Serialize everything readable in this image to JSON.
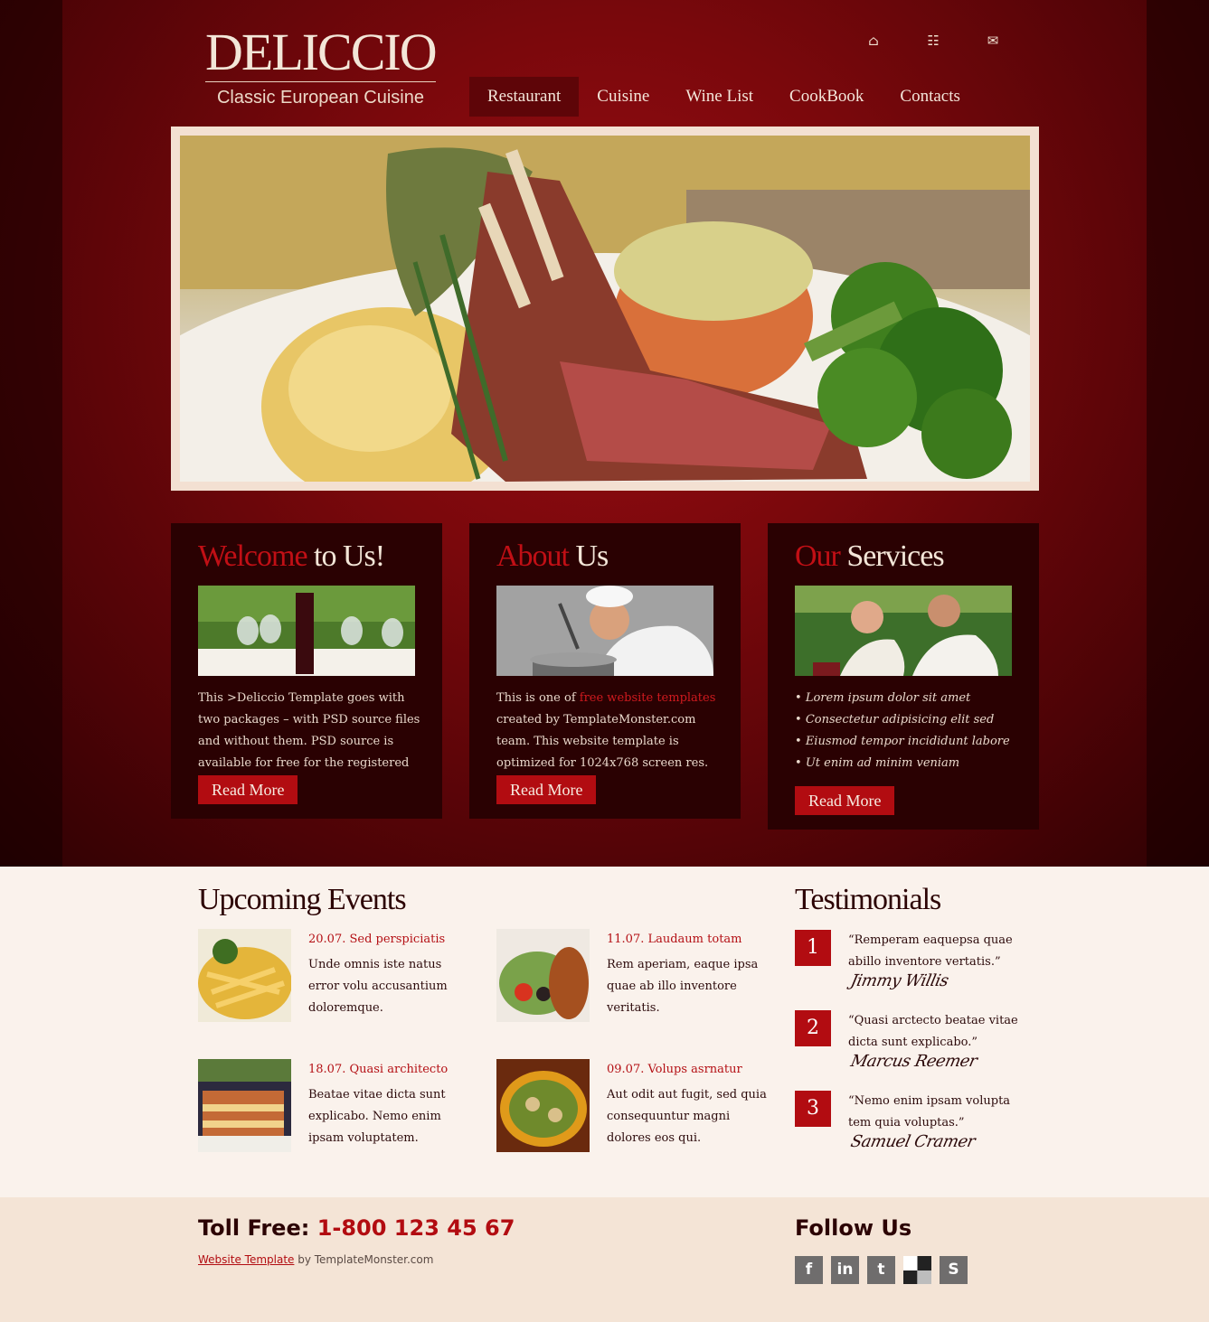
{
  "brand": {
    "name": "DELICCIO",
    "tagline": "Classic European Cuisine"
  },
  "top_icons": [
    {
      "name": "home-icon",
      "glyph": "⌂"
    },
    {
      "name": "sitemap-icon",
      "glyph": "☷"
    },
    {
      "name": "mail-icon",
      "glyph": "✉"
    }
  ],
  "nav": [
    "Restaurant",
    "Cuisine",
    "Wine List",
    "CookBook",
    "Contacts"
  ],
  "boxes": {
    "welcome": {
      "title_red": "Welcome",
      "title_rest": "to Us!",
      "text": "This >Deliccio Template goes with two packages – with PSD source files and without them. PSD source is available for free for the registered members.",
      "button": "Read More"
    },
    "about": {
      "title_red": "About",
      "title_rest": "Us",
      "text_before": "This is one of ",
      "link": "free website templates",
      "text_after": " created by TemplateMonster.com team. This website template is optimized for 1024x768 screen res.",
      "button": "Read More"
    },
    "services": {
      "title_red": "Our",
      "title_rest": "Services",
      "items": [
        "Lorem ipsum dolor sit amet",
        "Consectetur adipisicing elit sed",
        "Eiusmod tempor incididunt labore",
        "Ut enim ad minim veniam"
      ],
      "button": "Read More"
    }
  },
  "events": {
    "title": "Upcoming Events",
    "items": [
      {
        "date": "20.07. Sed perspiciatis",
        "text": "Unde omnis iste natus error volu accusantium doloremque."
      },
      {
        "date": "11.07. Laudaum totam",
        "text": "Rem aperiam, eaque ipsa quae ab illo inventore veritatis."
      },
      {
        "date": "18.07. Quasi architecto",
        "text": "Beatae vitae dicta sunt explicabo. Nemo enim ipsam voluptatem."
      },
      {
        "date": "09.07. Volups asrnatur",
        "text": "Aut odit aut fugit, sed quia consequuntur magni dolores eos qui."
      }
    ]
  },
  "testimonials": {
    "title": "Testimonials",
    "items": [
      {
        "num": "1",
        "quote": "“Remperam eaquepsa quae abillo inventore vertatis.”",
        "author": "Jimmy Willis"
      },
      {
        "num": "2",
        "quote": "“Quasi arctecto beatae vitae dicta sunt explicabo.”",
        "author": "Marcus Reemer"
      },
      {
        "num": "3",
        "quote": "“Nemo enim ipsam volupta tem quia voluptas.”",
        "author": "Samuel Cramer"
      }
    ]
  },
  "footer": {
    "toll_label": "Toll Free:",
    "phone": "1-800 123 45 67",
    "credit_link": "Website Template",
    "credit_rest": " by TemplateMonster.com",
    "follow_title": "Follow Us",
    "social": [
      {
        "name": "facebook-icon",
        "glyph": "f"
      },
      {
        "name": "linkedin-icon",
        "glyph": "in"
      },
      {
        "name": "twitter-icon",
        "glyph": "t"
      },
      {
        "name": "delicious-icon",
        "glyph": ""
      },
      {
        "name": "stumbleupon-icon",
        "glyph": "S"
      }
    ]
  },
  "colors": {
    "accent": "#b20c11",
    "dark": "#2a0102",
    "cream": "#faf2ec"
  }
}
